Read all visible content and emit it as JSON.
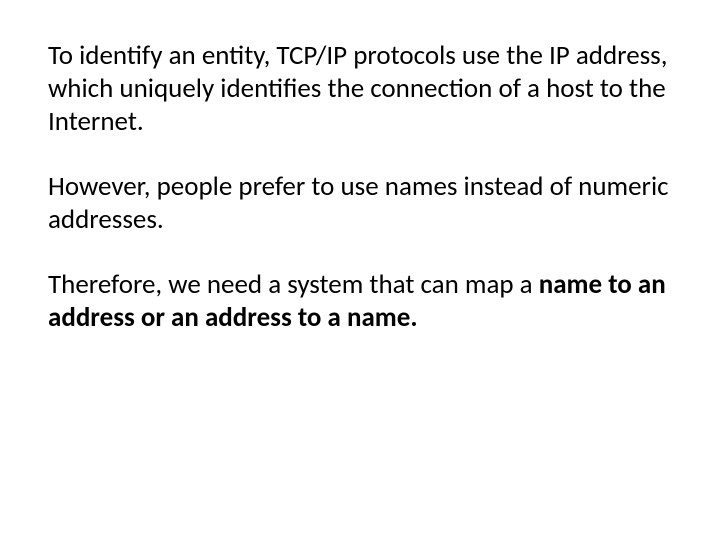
{
  "paragraphs": {
    "p1": "To identify an entity, TCP/IP protocols use the IP address, which uniquely identifies the connection of a host to the Internet.",
    "p2": "However, people prefer to use names instead of numeric addresses.",
    "p3_prefix": "Therefore, we need a system that can map a ",
    "p3_bold": "name to an address or an address to a name."
  }
}
